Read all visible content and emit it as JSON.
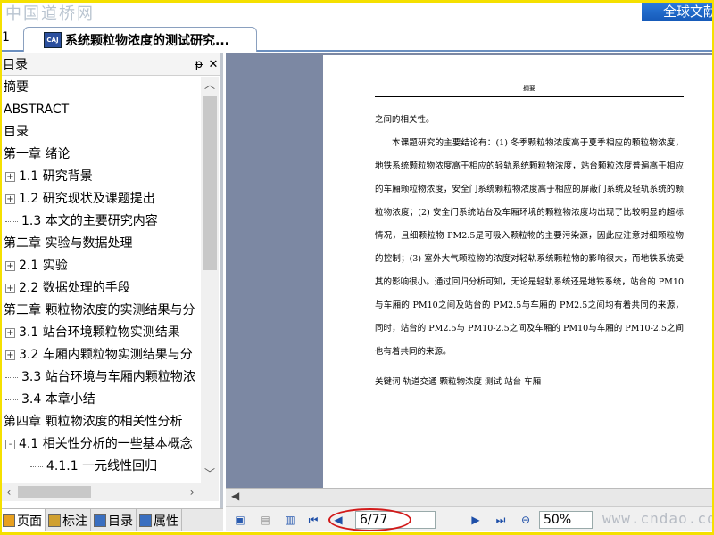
{
  "banner": {
    "logo": "中国道桥网",
    "global_button": "全球文献"
  },
  "tabs": {
    "prev_glyph": "1",
    "doc_icon_text": "CAJ",
    "doc_title": "系统颗粒物浓度的测试研究..."
  },
  "sidebar": {
    "title": "目录",
    "pin_glyph": "ᵽ",
    "close_glyph": "✕",
    "toc": [
      {
        "label": "摘要",
        "level": 0,
        "expand": ""
      },
      {
        "label": "ABSTRACT",
        "level": 0,
        "expand": ""
      },
      {
        "label": "目录",
        "level": 0,
        "expand": ""
      },
      {
        "label": "第一章 绪论",
        "level": 0,
        "expand": ""
      },
      {
        "label": "1.1 研究背景",
        "level": 1,
        "expand": "+"
      },
      {
        "label": "1.2 研究现状及课题提出",
        "level": 1,
        "expand": "+"
      },
      {
        "label": "1.3 本文的主要研究内容",
        "level": 1,
        "expand": "dots"
      },
      {
        "label": "第二章 实验与数据处理",
        "level": 0,
        "expand": ""
      },
      {
        "label": "2.1 实验",
        "level": 1,
        "expand": "+"
      },
      {
        "label": "2.2 数据处理的手段",
        "level": 1,
        "expand": "+"
      },
      {
        "label": "第三章 颗粒物浓度的实测结果与分",
        "level": 0,
        "expand": ""
      },
      {
        "label": "3.1 站台环境颗粒物实测结果",
        "level": 1,
        "expand": "+"
      },
      {
        "label": "3.2 车厢内颗粒物实测结果与分",
        "level": 1,
        "expand": "+"
      },
      {
        "label": "3.3 站台环境与车厢内颗粒物浓",
        "level": 1,
        "expand": "dots"
      },
      {
        "label": "3.4 本章小结",
        "level": 1,
        "expand": "dots"
      },
      {
        "label": "第四章 颗粒物浓度的相关性分析",
        "level": 0,
        "expand": ""
      },
      {
        "label": "4.1 相关性分析的一些基本概念",
        "level": 1,
        "expand": "-"
      },
      {
        "label": "4.1.1 一元线性回归",
        "level": 2,
        "expand": "dots"
      }
    ],
    "bottom_tabs": [
      {
        "label": "页面",
        "active": true
      },
      {
        "label": "标注",
        "active": false
      },
      {
        "label": "目录",
        "active": false
      },
      {
        "label": "属性",
        "active": false
      }
    ]
  },
  "document": {
    "header": "摘要",
    "line1": "之间的相关性。",
    "para": "本课题研究的主要结论有：(1) 冬季颗粒物浓度高于夏季相应的颗粒物浓度，地铁系统颗粒物浓度高于相应的轻轨系统颗粒物浓度，站台颗粒浓度普遍高于相应的车厢颗粒物浓度，安全门系统颗粒物浓度高于相应的屏蔽门系统及轻轨系统的颗粒物浓度；(2) 安全门系统站台及车厢环境的颗粒物浓度均出现了比较明显的超标情况，且细颗粒物 PM2.5是可吸入颗粒物的主要污染源，因此应注意对细颗粒物的控制；(3) 室外大气颗粒物的浓度对轻轨系统颗粒物的影响很大，而地铁系统受其的影响很小。通过回归分析可知，无论是轻轨系统还是地铁系统，站台的 PM10与车厢的 PM10之间及站台的 PM2.5与车厢的 PM2.5之间均有着共同的来源，同时，站台的 PM2.5与 PM10-2.5之间及车厢的 PM10与车厢的 PM10-2.5之间也有着共同的来源。",
    "keywords": "关键词   轨道交通  颗粒物浓度  测试  站台  车厢"
  },
  "navbar": {
    "page_value": "6/77",
    "zoom_value": "50%",
    "watermark": "www.cndao.com"
  },
  "colors": {
    "viewer_bg": "#7c88a3",
    "frame": "#f5e000",
    "highlight_ring": "#d21a1a"
  }
}
